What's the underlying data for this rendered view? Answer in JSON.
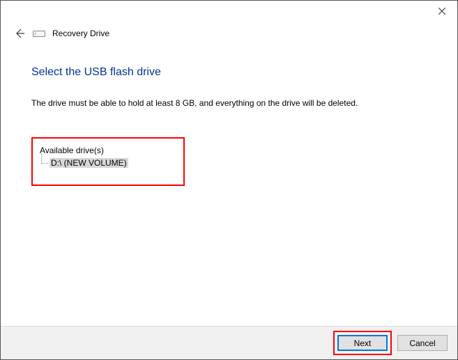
{
  "window": {
    "wizard_title": "Recovery Drive"
  },
  "content": {
    "heading": "Select the USB flash drive",
    "description": "The drive must be able to hold at least 8 GB, and everything on the drive will be deleted.",
    "drives_label": "Available drive(s)",
    "drives": [
      {
        "label": "D:\\ (NEW VOLUME)"
      }
    ]
  },
  "footer": {
    "next_label": "Next",
    "cancel_label": "Cancel"
  }
}
